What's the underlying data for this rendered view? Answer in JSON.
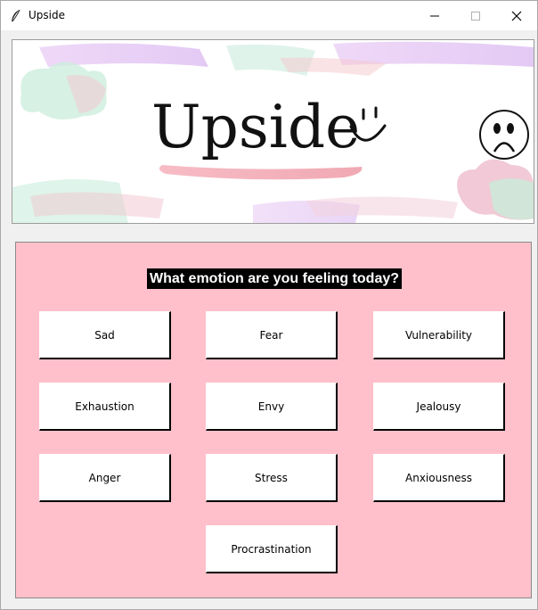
{
  "window": {
    "title": "Upside",
    "controls": [
      "minimize",
      "maximize",
      "close"
    ]
  },
  "banner": {
    "logo_text": "Upside",
    "smiley": "smiley-icon",
    "sad_face": "sad-face-icon"
  },
  "panel": {
    "question": "What emotion are you feeling today?",
    "background_color": "#ffc0cb",
    "emotions": [
      "Sad",
      "Fear",
      "Vulnerability",
      "Exhaustion",
      "Envy",
      "Jealousy",
      "Anger",
      "Stress",
      "Anxiousness",
      "Procrastination"
    ]
  },
  "colors": {
    "question_bg": "#000000",
    "question_fg": "#ffffff",
    "button_bg": "#ffffff"
  }
}
